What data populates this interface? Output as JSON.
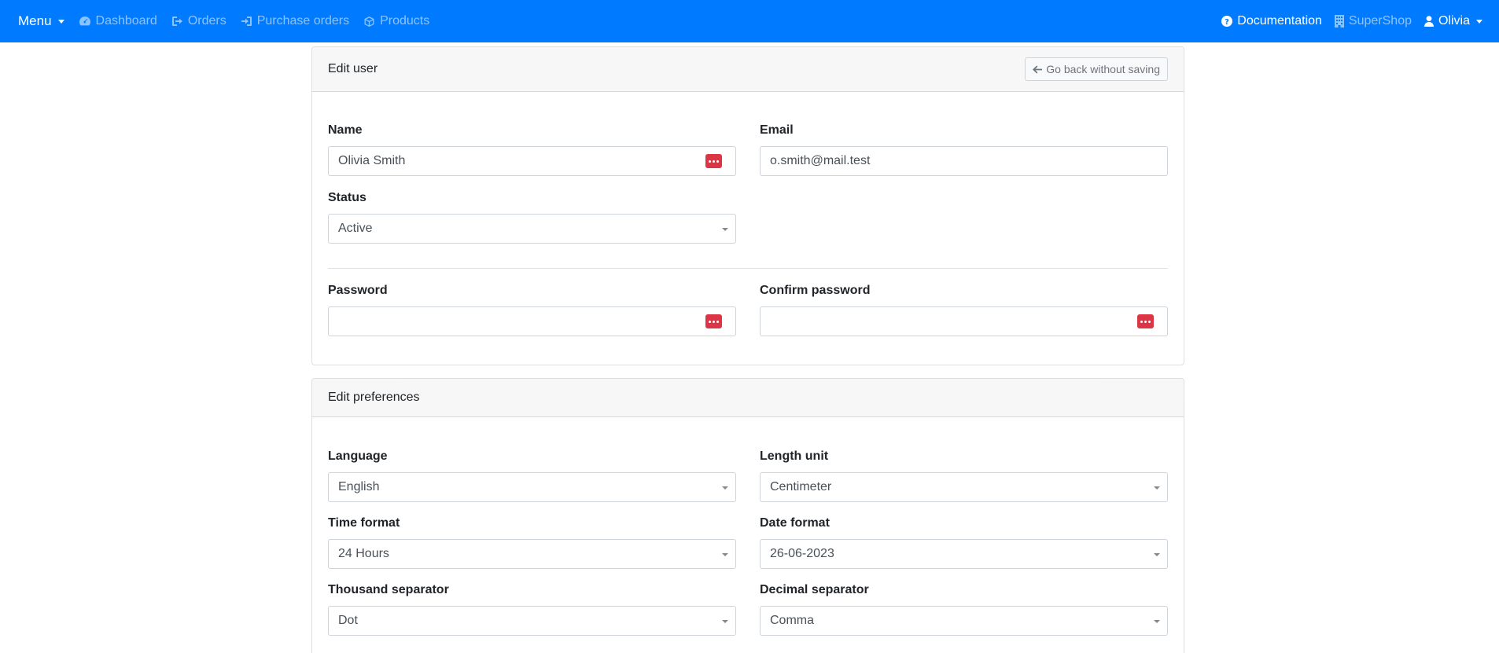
{
  "navbar": {
    "menu_label": "Menu",
    "links": [
      "Dashboard",
      "Orders",
      "Purchase orders",
      "Products"
    ],
    "documentation": "Documentation",
    "shop": "SuperShop",
    "user": "Olivia"
  },
  "edit_user": {
    "title": "Edit user",
    "back_button": "Go back without saving",
    "name_label": "Name",
    "name_value": "Olivia Smith",
    "email_label": "Email",
    "email_value": "o.smith@mail.test",
    "status_label": "Status",
    "status_value": "Active",
    "password_label": "Password",
    "password_value": "",
    "confirm_password_label": "Confirm password",
    "confirm_password_value": ""
  },
  "edit_preferences": {
    "title": "Edit preferences",
    "language_label": "Language",
    "language_value": "English",
    "length_unit_label": "Length unit",
    "length_unit_value": "Centimeter",
    "time_format_label": "Time format",
    "time_format_value": "24 Hours",
    "date_format_label": "Date format",
    "date_format_value": "26-06-2023",
    "thousand_separator_label": "Thousand separator",
    "thousand_separator_value": "Dot",
    "decimal_separator_label": "Decimal separator",
    "decimal_separator_value": "Comma"
  },
  "colors": {
    "navbar": "#007bff",
    "password_manager_icon": "#dc3545"
  }
}
